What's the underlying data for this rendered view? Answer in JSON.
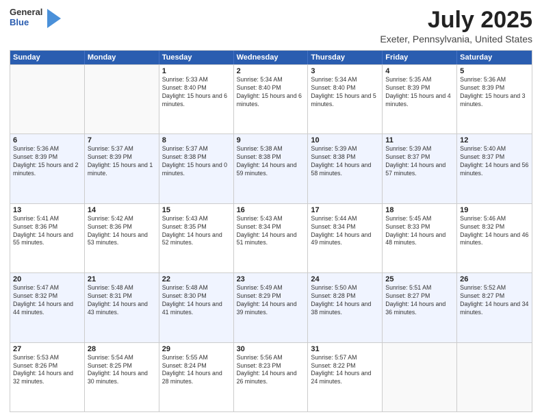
{
  "header": {
    "logo": {
      "general": "General",
      "blue": "Blue"
    },
    "title": "July 2025",
    "location": "Exeter, Pennsylvania, United States"
  },
  "weekdays": [
    "Sunday",
    "Monday",
    "Tuesday",
    "Wednesday",
    "Thursday",
    "Friday",
    "Saturday"
  ],
  "rows": [
    [
      {
        "day": "",
        "sunrise": "",
        "sunset": "",
        "daylight": "",
        "empty": true
      },
      {
        "day": "",
        "sunrise": "",
        "sunset": "",
        "daylight": "",
        "empty": true
      },
      {
        "day": "1",
        "sunrise": "Sunrise: 5:33 AM",
        "sunset": "Sunset: 8:40 PM",
        "daylight": "Daylight: 15 hours and 6 minutes."
      },
      {
        "day": "2",
        "sunrise": "Sunrise: 5:34 AM",
        "sunset": "Sunset: 8:40 PM",
        "daylight": "Daylight: 15 hours and 6 minutes."
      },
      {
        "day": "3",
        "sunrise": "Sunrise: 5:34 AM",
        "sunset": "Sunset: 8:40 PM",
        "daylight": "Daylight: 15 hours and 5 minutes."
      },
      {
        "day": "4",
        "sunrise": "Sunrise: 5:35 AM",
        "sunset": "Sunset: 8:39 PM",
        "daylight": "Daylight: 15 hours and 4 minutes."
      },
      {
        "day": "5",
        "sunrise": "Sunrise: 5:36 AM",
        "sunset": "Sunset: 8:39 PM",
        "daylight": "Daylight: 15 hours and 3 minutes."
      }
    ],
    [
      {
        "day": "6",
        "sunrise": "Sunrise: 5:36 AM",
        "sunset": "Sunset: 8:39 PM",
        "daylight": "Daylight: 15 hours and 2 minutes."
      },
      {
        "day": "7",
        "sunrise": "Sunrise: 5:37 AM",
        "sunset": "Sunset: 8:39 PM",
        "daylight": "Daylight: 15 hours and 1 minute."
      },
      {
        "day": "8",
        "sunrise": "Sunrise: 5:37 AM",
        "sunset": "Sunset: 8:38 PM",
        "daylight": "Daylight: 15 hours and 0 minutes."
      },
      {
        "day": "9",
        "sunrise": "Sunrise: 5:38 AM",
        "sunset": "Sunset: 8:38 PM",
        "daylight": "Daylight: 14 hours and 59 minutes."
      },
      {
        "day": "10",
        "sunrise": "Sunrise: 5:39 AM",
        "sunset": "Sunset: 8:38 PM",
        "daylight": "Daylight: 14 hours and 58 minutes."
      },
      {
        "day": "11",
        "sunrise": "Sunrise: 5:39 AM",
        "sunset": "Sunset: 8:37 PM",
        "daylight": "Daylight: 14 hours and 57 minutes."
      },
      {
        "day": "12",
        "sunrise": "Sunrise: 5:40 AM",
        "sunset": "Sunset: 8:37 PM",
        "daylight": "Daylight: 14 hours and 56 minutes."
      }
    ],
    [
      {
        "day": "13",
        "sunrise": "Sunrise: 5:41 AM",
        "sunset": "Sunset: 8:36 PM",
        "daylight": "Daylight: 14 hours and 55 minutes."
      },
      {
        "day": "14",
        "sunrise": "Sunrise: 5:42 AM",
        "sunset": "Sunset: 8:36 PM",
        "daylight": "Daylight: 14 hours and 53 minutes."
      },
      {
        "day": "15",
        "sunrise": "Sunrise: 5:43 AM",
        "sunset": "Sunset: 8:35 PM",
        "daylight": "Daylight: 14 hours and 52 minutes."
      },
      {
        "day": "16",
        "sunrise": "Sunrise: 5:43 AM",
        "sunset": "Sunset: 8:34 PM",
        "daylight": "Daylight: 14 hours and 51 minutes."
      },
      {
        "day": "17",
        "sunrise": "Sunrise: 5:44 AM",
        "sunset": "Sunset: 8:34 PM",
        "daylight": "Daylight: 14 hours and 49 minutes."
      },
      {
        "day": "18",
        "sunrise": "Sunrise: 5:45 AM",
        "sunset": "Sunset: 8:33 PM",
        "daylight": "Daylight: 14 hours and 48 minutes."
      },
      {
        "day": "19",
        "sunrise": "Sunrise: 5:46 AM",
        "sunset": "Sunset: 8:32 PM",
        "daylight": "Daylight: 14 hours and 46 minutes."
      }
    ],
    [
      {
        "day": "20",
        "sunrise": "Sunrise: 5:47 AM",
        "sunset": "Sunset: 8:32 PM",
        "daylight": "Daylight: 14 hours and 44 minutes."
      },
      {
        "day": "21",
        "sunrise": "Sunrise: 5:48 AM",
        "sunset": "Sunset: 8:31 PM",
        "daylight": "Daylight: 14 hours and 43 minutes."
      },
      {
        "day": "22",
        "sunrise": "Sunrise: 5:48 AM",
        "sunset": "Sunset: 8:30 PM",
        "daylight": "Daylight: 14 hours and 41 minutes."
      },
      {
        "day": "23",
        "sunrise": "Sunrise: 5:49 AM",
        "sunset": "Sunset: 8:29 PM",
        "daylight": "Daylight: 14 hours and 39 minutes."
      },
      {
        "day": "24",
        "sunrise": "Sunrise: 5:50 AM",
        "sunset": "Sunset: 8:28 PM",
        "daylight": "Daylight: 14 hours and 38 minutes."
      },
      {
        "day": "25",
        "sunrise": "Sunrise: 5:51 AM",
        "sunset": "Sunset: 8:27 PM",
        "daylight": "Daylight: 14 hours and 36 minutes."
      },
      {
        "day": "26",
        "sunrise": "Sunrise: 5:52 AM",
        "sunset": "Sunset: 8:27 PM",
        "daylight": "Daylight: 14 hours and 34 minutes."
      }
    ],
    [
      {
        "day": "27",
        "sunrise": "Sunrise: 5:53 AM",
        "sunset": "Sunset: 8:26 PM",
        "daylight": "Daylight: 14 hours and 32 minutes."
      },
      {
        "day": "28",
        "sunrise": "Sunrise: 5:54 AM",
        "sunset": "Sunset: 8:25 PM",
        "daylight": "Daylight: 14 hours and 30 minutes."
      },
      {
        "day": "29",
        "sunrise": "Sunrise: 5:55 AM",
        "sunset": "Sunset: 8:24 PM",
        "daylight": "Daylight: 14 hours and 28 minutes."
      },
      {
        "day": "30",
        "sunrise": "Sunrise: 5:56 AM",
        "sunset": "Sunset: 8:23 PM",
        "daylight": "Daylight: 14 hours and 26 minutes."
      },
      {
        "day": "31",
        "sunrise": "Sunrise: 5:57 AM",
        "sunset": "Sunset: 8:22 PM",
        "daylight": "Daylight: 14 hours and 24 minutes."
      },
      {
        "day": "",
        "sunrise": "",
        "sunset": "",
        "daylight": "",
        "empty": true
      },
      {
        "day": "",
        "sunrise": "",
        "sunset": "",
        "daylight": "",
        "empty": true
      }
    ]
  ]
}
